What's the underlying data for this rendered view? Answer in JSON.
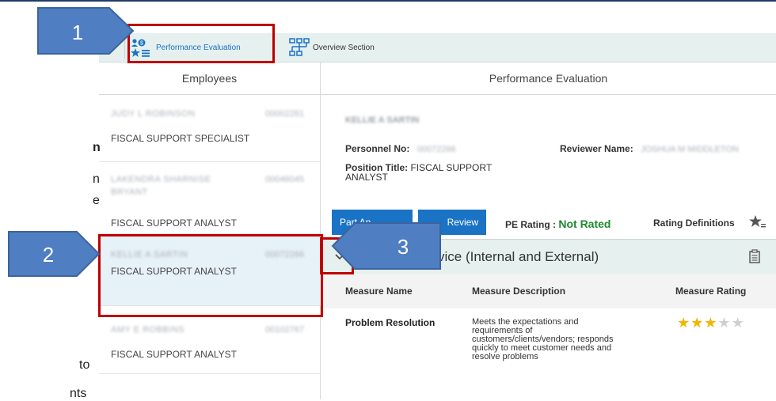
{
  "background_text": {
    "line1": "n",
    "line2": "n",
    "line3": "e",
    "line4": "to",
    "line5": "nts"
  },
  "tabs": {
    "performance": "Performance Evaluation",
    "overview": "Overview Section"
  },
  "columns": {
    "employees": "Employees",
    "performance": "Performance Evaluation"
  },
  "employees": [
    {
      "name": "JUDY L ROBINSON",
      "number": "00002261",
      "title": "FISCAL SUPPORT SPECIALIST"
    },
    {
      "name": "LAKENDRA SHARNISE",
      "name2": "BRYANT",
      "number": "00046045",
      "title": "FISCAL SUPPORT ANALYST"
    },
    {
      "name": "KELLIE A SARTIN",
      "number": "00072266",
      "title": "FISCAL SUPPORT ANALYST"
    },
    {
      "name": "AMY E ROBBINS",
      "number": "00102767",
      "title": "FISCAL SUPPORT ANALYST"
    }
  ],
  "detail": {
    "employee_name": "KELLIE A SARTIN",
    "personnel_label": "Personnel No:",
    "personnel_value": "00072266",
    "reviewer_label": "Reviewer Name:",
    "reviewer_value": "JOSHUA M MIDDLETON",
    "position_label": "Position Title:",
    "position_value_1": "FISCAL SUPPORT",
    "position_value_2": "ANALYST"
  },
  "buttons": {
    "part_a": "Part An",
    "review": "Review"
  },
  "rating": {
    "label": "PE Rating :",
    "value": "Not Rated",
    "definitions": "Rating Definitions"
  },
  "section": {
    "title": "vice (Internal and External)",
    "prefix": "C"
  },
  "table": {
    "headers": [
      "Measure Name",
      "Measure Description",
      "Measure Rating"
    ],
    "rows": [
      {
        "name": "Problem Resolution",
        "description_lines": [
          "Meets the expectations and",
          "requirements of",
          "customers/clients/vendors; responds",
          "quickly to meet customer needs and",
          "resolve problems"
        ],
        "rating": 3,
        "max_rating": 5
      }
    ]
  },
  "callouts": [
    "1",
    "2",
    "3"
  ],
  "colors": {
    "accent": "#1a73c4",
    "green": "#1e8a2e",
    "callout": "#4f7ec2",
    "highlight": "#c00000",
    "star": "#f5b400"
  }
}
